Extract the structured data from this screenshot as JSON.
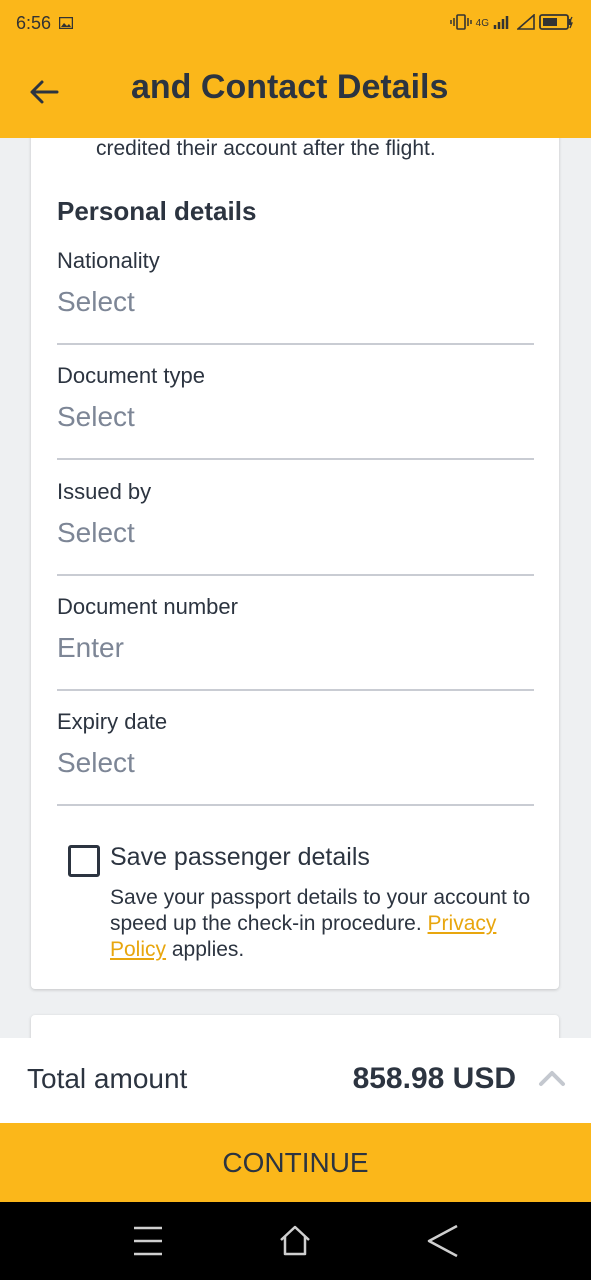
{
  "status_bar": {
    "time": "6:56",
    "network": "4G"
  },
  "header": {
    "title": "and Contact Details"
  },
  "card": {
    "intro_text": "carried from this passenger's flight will be credited their account after the flight.",
    "section_title": "Personal details",
    "fields": [
      {
        "label": "Nationality",
        "value": "Select"
      },
      {
        "label": "Document type",
        "value": "Select"
      },
      {
        "label": "Issued by",
        "value": "Select"
      },
      {
        "label": "Document number",
        "value": "Enter"
      },
      {
        "label": "Expiry date",
        "value": "Select"
      }
    ],
    "save": {
      "label": "Save passenger details",
      "desc_prefix": "Save your passport details to your account to speed up the check-in procedure.",
      "link": "Privacy Policy",
      "desc_suffix": "applies.",
      "checked": false
    }
  },
  "footer": {
    "total_label": "Total amount",
    "total_value": "858.98 USD",
    "continue_label": "CONTINUE"
  },
  "colors": {
    "accent": "#fbb71a",
    "text": "#2c3440",
    "placeholder": "#7d8696"
  }
}
